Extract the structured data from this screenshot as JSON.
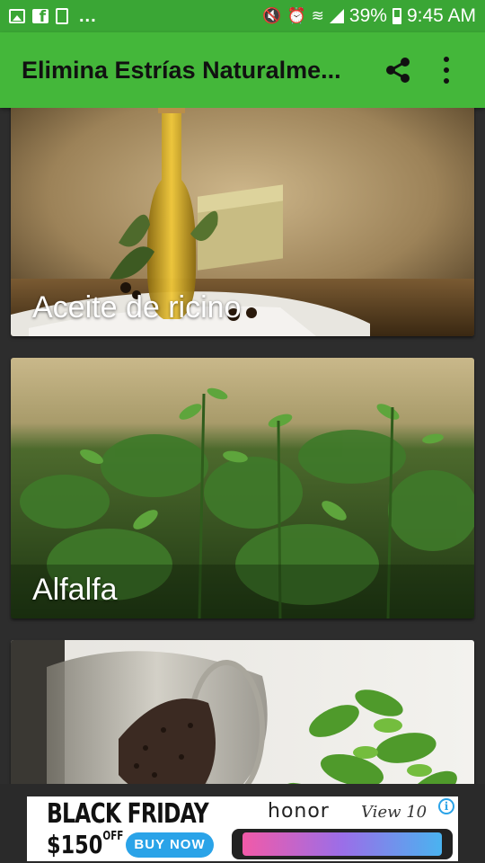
{
  "status_bar": {
    "notification_icons": [
      "image-icon",
      "facebook-icon",
      "clipboard-icon"
    ],
    "overflow": "...",
    "battery": "39%",
    "time": "9:45 AM"
  },
  "app_bar": {
    "title": "Elimina Estrías Naturalme...",
    "share_icon": "share-icon",
    "more_icon": "more-vert-icon",
    "color": "#44b73a"
  },
  "items": [
    {
      "label": "Aceite de ricino"
    },
    {
      "label": "Alfalfa"
    },
    {
      "label": ""
    }
  ],
  "ad": {
    "headline": "BLACK FRIDAY",
    "price": "$150",
    "price_suffix": "OFF",
    "cta": "BUY NOW",
    "brand": "honor",
    "model": "View 10",
    "info_icon": "info-icon"
  }
}
